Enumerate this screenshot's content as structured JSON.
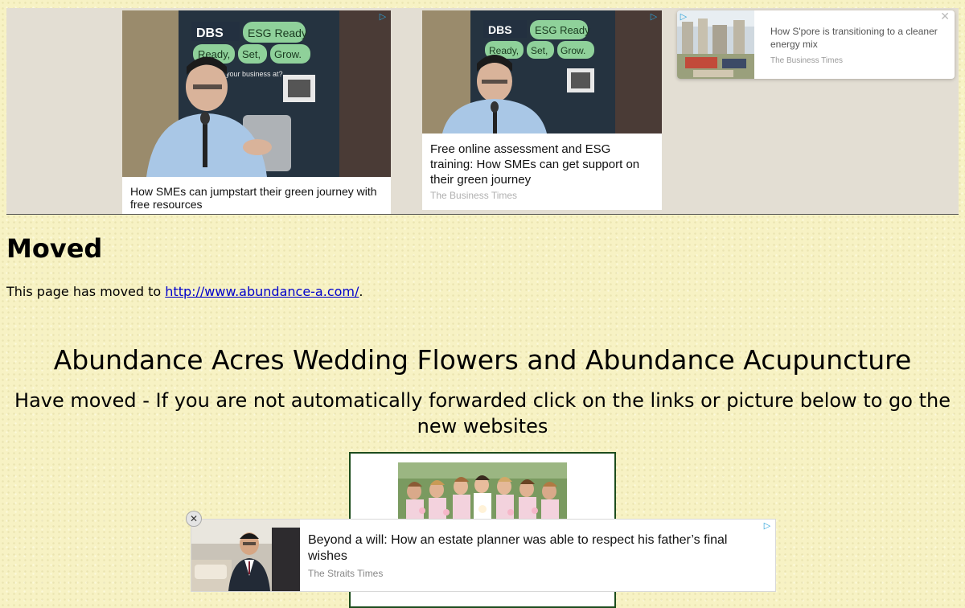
{
  "ads_top": {
    "card_a": {
      "text": "How SMEs can jumpstart their green journey with free resources"
    },
    "card_b": {
      "text": "Free online assessment and ESG training: How SMEs can get support on their green journey",
      "source": "The Business Times"
    },
    "card_c": {
      "text": "How S'pore is transitioning to a cleaner energy mix",
      "source": "The Business Times",
      "close": "✕"
    },
    "adchoice_icon": "▷",
    "banner_brand": "DBS",
    "banner_slogan": [
      "ESG Ready",
      "Ready,",
      "Set,",
      "Grow."
    ],
    "banner_question": "is your business at?"
  },
  "main": {
    "title": "Moved",
    "text_before": "This page has moved to ",
    "link_text": "http://www.abundance-a.com/",
    "text_after": ".",
    "site_title": "Abundance Acres Wedding Flowers and Abundance Acupuncture",
    "site_subtitle": "Have moved - If you are not automatically forwarded click on the links or picture below to go the new websites"
  },
  "ad_bottom": {
    "text": "Beyond a will: How an estate planner was able to respect his father’s final wishes",
    "source": "The Straits Times",
    "close": "✕"
  },
  "colors": {
    "page_bg": "#f7f2c4",
    "link": "#0000cc",
    "frame_border": "#1d4d1d",
    "adchoice": "#2aa1d8"
  }
}
